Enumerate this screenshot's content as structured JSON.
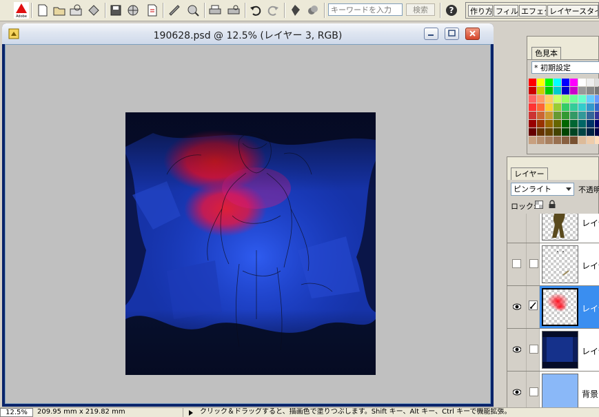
{
  "toolbar": {
    "search": {
      "placeholder": "キーワードを入力"
    },
    "search_button": "検索",
    "palette_well_tabs": [
      "作り方",
      "フィルタ",
      "エフェクト",
      "レイヤースタイル"
    ]
  },
  "document": {
    "title": "190628.psd @ 12.5% (レイヤー 3, RGB)"
  },
  "swatches": {
    "tab": "色見本",
    "preset": "* 初期設定",
    "rows": [
      [
        "#ff0000",
        "#ffff00",
        "#00ff00",
        "#00ffff",
        "#0000ff",
        "#ff00ff",
        "#ffffff",
        "#eeeeee",
        "#dddddd",
        "#cccccc"
      ],
      [
        "#cc0000",
        "#cccc00",
        "#00cc00",
        "#00cccc",
        "#0000cc",
        "#cc00cc",
        "#999999",
        "#888888",
        "#777777",
        "#666666"
      ],
      [
        "#ff6666",
        "#ff9966",
        "#ffcc66",
        "#ccff66",
        "#99ff66",
        "#66ff99",
        "#66ffcc",
        "#66ccff",
        "#6699ff",
        "#9966ff"
      ],
      [
        "#ff3333",
        "#ff6633",
        "#ffcc33",
        "#99cc33",
        "#33cc66",
        "#33cc99",
        "#33cccc",
        "#3399cc",
        "#3366cc",
        "#6633cc"
      ],
      [
        "#cc3333",
        "#cc6633",
        "#cc9933",
        "#669933",
        "#339933",
        "#339966",
        "#339999",
        "#336699",
        "#333399",
        "#663399"
      ],
      [
        "#990000",
        "#993300",
        "#996600",
        "#666600",
        "#006600",
        "#006633",
        "#006666",
        "#003366",
        "#000066",
        "#330066"
      ],
      [
        "#660000",
        "#663300",
        "#664400",
        "#444400",
        "#004400",
        "#004422",
        "#004444",
        "#002244",
        "#000044",
        "#220044"
      ],
      [
        "#c8a080",
        "#b89070",
        "#a88060",
        "#987050",
        "#886040",
        "#785030",
        "#ddbb99",
        "#eeccaa",
        "#ffddbb",
        "#ccaa88"
      ]
    ]
  },
  "layers": {
    "tab": "レイヤー",
    "blend_mode": "ピンライト",
    "opacity_label": "不透明",
    "lock_label": "ロック:",
    "items": [
      {
        "name": "レイヤー",
        "visible": false,
        "selected": false
      },
      {
        "name": "レイヤー",
        "visible": false,
        "selected": false
      },
      {
        "name": "レイヤー",
        "visible": true,
        "selected": true
      },
      {
        "name": "レイヤー",
        "visible": true,
        "selected": false
      },
      {
        "name": "背景",
        "visible": true,
        "selected": false
      }
    ]
  },
  "status": {
    "zoom": "12.5%",
    "doc_size": "209.95 mm x 219.82 mm",
    "hint": "クリック＆ドラッグすると、描画色で塗りつぶします。Shift キー、Alt キー、Ctrl キーで機能拡張。"
  }
}
